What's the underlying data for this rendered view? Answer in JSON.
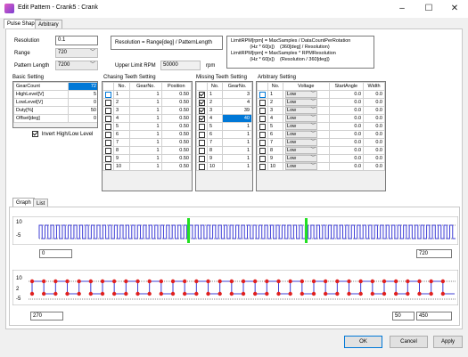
{
  "window": {
    "title": "Edit Pattern - Crank5 : Crank",
    "min": "–",
    "max": "☐",
    "close": "✕"
  },
  "tabs": [
    "Pulse Shape",
    "Arbitrary"
  ],
  "form": {
    "resolution_label": "Resolution",
    "resolution_value": "0.1",
    "range_label": "Range",
    "range_value": "720",
    "pattern_length_label": "Pattern Length",
    "pattern_length_value": "7200",
    "formula1": "Resolution = Range[deg] / PatternLength",
    "upper_limit_label": "Upper Limit RPM",
    "upper_limit_value": "50000",
    "upper_limit_unit": "rpm",
    "formula2": "LimitRPM[rpm] = MaxSamples / DataCountPerRotation\n              (Hz * 60[s])    (360[deg] / Resolution)\nLimitRPM[rpm] = MaxSamples * RPMResolution\n              (Hz * 60[s])    (Resolution / 360[deg])"
  },
  "basic": {
    "title": "Basic Setting",
    "rows": [
      {
        "k": "GearCount",
        "v": "72"
      },
      {
        "k": "HighLevel[V]",
        "v": "5"
      },
      {
        "k": "LowLevel[V]",
        "v": "0"
      },
      {
        "k": "Duty[%]",
        "v": "50"
      },
      {
        "k": "Offset[deg]",
        "v": "0"
      }
    ],
    "invert_label": "Invert High/Low Level"
  },
  "chasing": {
    "title": "Chasing Teeth Setting",
    "headers": [
      "No.",
      "GearNo.",
      "Position"
    ],
    "rows": [
      [
        "1",
        "1",
        "0.50"
      ],
      [
        "2",
        "1",
        "0.50"
      ],
      [
        "3",
        "1",
        "0.50"
      ],
      [
        "4",
        "1",
        "0.50"
      ],
      [
        "5",
        "1",
        "0.50"
      ],
      [
        "6",
        "1",
        "0.50"
      ],
      [
        "7",
        "1",
        "0.50"
      ],
      [
        "8",
        "1",
        "0.50"
      ],
      [
        "9",
        "1",
        "0.50"
      ],
      [
        "10",
        "1",
        "0.50"
      ]
    ]
  },
  "missing": {
    "title": "Missing Teeth Setting",
    "headers": [
      "No.",
      "GearNo."
    ],
    "rows": [
      [
        "1",
        "3"
      ],
      [
        "2",
        "4"
      ],
      [
        "3",
        "39"
      ],
      [
        "4",
        "40"
      ],
      [
        "5",
        "1"
      ],
      [
        "6",
        "1"
      ],
      [
        "7",
        "1"
      ],
      [
        "8",
        "1"
      ],
      [
        "9",
        "1"
      ],
      [
        "10",
        "1"
      ]
    ]
  },
  "arbitrary": {
    "title": "Arbitrary Setting",
    "headers": [
      "No.",
      "Voltage",
      "StartAngle",
      "Width"
    ],
    "rows": [
      [
        "1",
        "Low",
        "0.0",
        "0.0"
      ],
      [
        "2",
        "Low",
        "0.0",
        "0.0"
      ],
      [
        "3",
        "Low",
        "0.0",
        "0.0"
      ],
      [
        "4",
        "Low",
        "0.0",
        "0.0"
      ],
      [
        "5",
        "Low",
        "0.0",
        "0.0"
      ],
      [
        "6",
        "Low",
        "0.0",
        "0.0"
      ],
      [
        "7",
        "Low",
        "0.0",
        "0.0"
      ],
      [
        "8",
        "Low",
        "0.0",
        "0.0"
      ],
      [
        "9",
        "Low",
        "0.0",
        "0.0"
      ],
      [
        "10",
        "Low",
        "0.0",
        "0.0"
      ]
    ]
  },
  "subtabs": [
    "Graph",
    "List"
  ],
  "graph1": {
    "y_high": "10",
    "y_low": "-5",
    "x_start": "0",
    "x_end": "720"
  },
  "graph2": {
    "y_high": "10",
    "y_mid": "2",
    "y_low": "-5",
    "x_start": "270",
    "zoom": "50",
    "x_end": "450"
  },
  "buttons": {
    "ok": "OK",
    "cancel": "Cancel",
    "apply": "Apply"
  }
}
